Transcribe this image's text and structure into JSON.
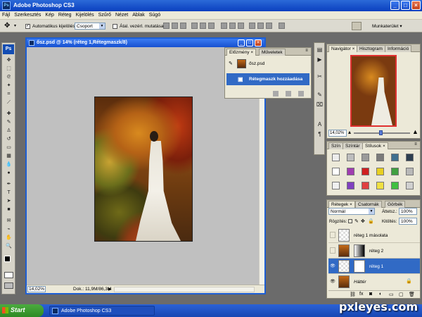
{
  "window": {
    "title": "Adobe Photoshop CS3"
  },
  "menu": [
    "Fájl",
    "Szerkesztés",
    "Kép",
    "Réteg",
    "Kijelölés",
    "Szűrő",
    "Nézet",
    "Ablak",
    "Súgó"
  ],
  "options": {
    "auto_select": "Automatikus kijelölés:",
    "auto_select_value": "Csoport",
    "transform": "Átal. vezérl. mutatása",
    "workspace": "Munkaterület"
  },
  "document": {
    "title": "ősz.psd @ 14% (réteg 1,Rétegmaszk/8)",
    "zoom": "14,02%",
    "docinfo": "Dok.: 11,9M/86,3M"
  },
  "history": {
    "tabs": [
      "Előzmény",
      "Műveletek"
    ],
    "items": [
      "ősz.psd",
      "Rétegmaszk hozzáadása"
    ]
  },
  "navigator": {
    "tabs": [
      "Navigátor",
      "Hisztogram",
      "Információ"
    ],
    "zoom": "14,02%"
  },
  "swatches": {
    "tabs": [
      "Szín",
      "Színtár",
      "Stílusok"
    ],
    "colors": [
      "#ececec",
      "#bdbdbd",
      "#9a9a9a",
      "#7a7a7a",
      "#3f6f8f",
      "#2c3e50",
      "#ffffff",
      "#a03cb0",
      "#d02020",
      "#e8d020",
      "#40a040",
      "#b8b8b8",
      "#f0f0f0",
      "#8040c0",
      "#e04040",
      "#f0e040",
      "#40c040",
      "#d0d0d0"
    ]
  },
  "layers": {
    "tabs": [
      "Rétegek",
      "Csatornák",
      "Görbék"
    ],
    "blend_mode": "Normál",
    "opacity_label": "Áttetsz.:",
    "opacity": "100%",
    "lock_label": "Rögzítés:",
    "fill_label": "Kitöltés:",
    "fill": "100%",
    "items": [
      {
        "name": "réteg 1 másolata"
      },
      {
        "name": "réteg 2"
      },
      {
        "name": "réteg 1"
      },
      {
        "name": "Háttér"
      }
    ]
  },
  "taskbar": {
    "start": "Start",
    "item": "Adobe Photoshop CS3"
  },
  "watermark": "pxleyes.com"
}
